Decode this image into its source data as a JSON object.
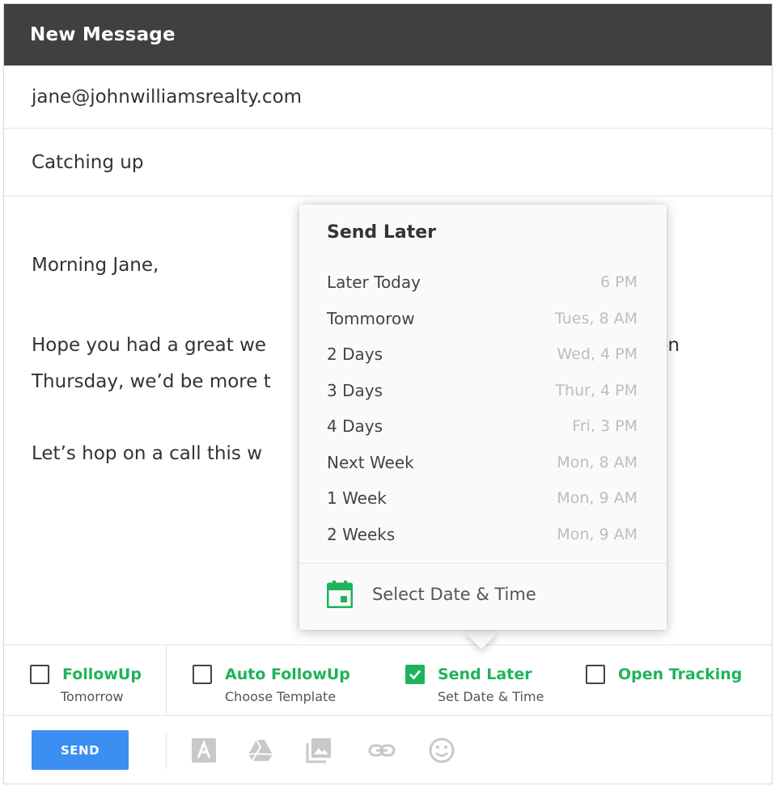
{
  "window": {
    "title": "New Message"
  },
  "fields": {
    "to_value": "jane@johnwilliamsrealty.com",
    "subject_value": "Catching up"
  },
  "body": {
    "greeting": "Morning Jane,",
    "line1": "Hope you had a great we",
    "line2": "Thursday, we’d be more t",
    "line3": "Let’s hop on a call this w",
    "line1_tail": "ion"
  },
  "send_later_menu": {
    "title": "Send Later",
    "items": [
      {
        "label": "Later Today",
        "time": "6 PM"
      },
      {
        "label": "Tommorow",
        "time": "Tues,  8 AM"
      },
      {
        "label": "2 Days",
        "time": "Wed, 4 PM"
      },
      {
        "label": "3 Days",
        "time": "Thur, 4 PM"
      },
      {
        "label": "4 Days",
        "time": "Fri, 3 PM"
      },
      {
        "label": "Next Week",
        "time": "Mon, 8 AM"
      },
      {
        "label": "1 Week",
        "time": "Mon, 9 AM"
      },
      {
        "label": "2 Weeks",
        "time": "Mon, 9 AM"
      }
    ],
    "footer_label": "Select Date & Time",
    "footer_icon": "calendar-icon"
  },
  "options": {
    "followup": {
      "label": "FollowUp",
      "sub": "Tomorrow",
      "checked": false
    },
    "auto_followup": {
      "label": "Auto FollowUp",
      "sub": "Choose Template",
      "checked": false
    },
    "send_later": {
      "label": "Send Later",
      "sub": "Set Date & Time",
      "checked": true
    },
    "open_tracking": {
      "label": "Open Tracking",
      "checked": false
    }
  },
  "toolbar": {
    "send_label": "SEND",
    "icons": [
      "text-format-icon",
      "drive-icon",
      "image-icon",
      "link-icon",
      "emoji-icon"
    ]
  },
  "colors": {
    "header_bg": "#404040",
    "accent_green": "#1fb35b",
    "send_blue": "#3b8ef2",
    "muted_text": "#bdbdbd"
  }
}
